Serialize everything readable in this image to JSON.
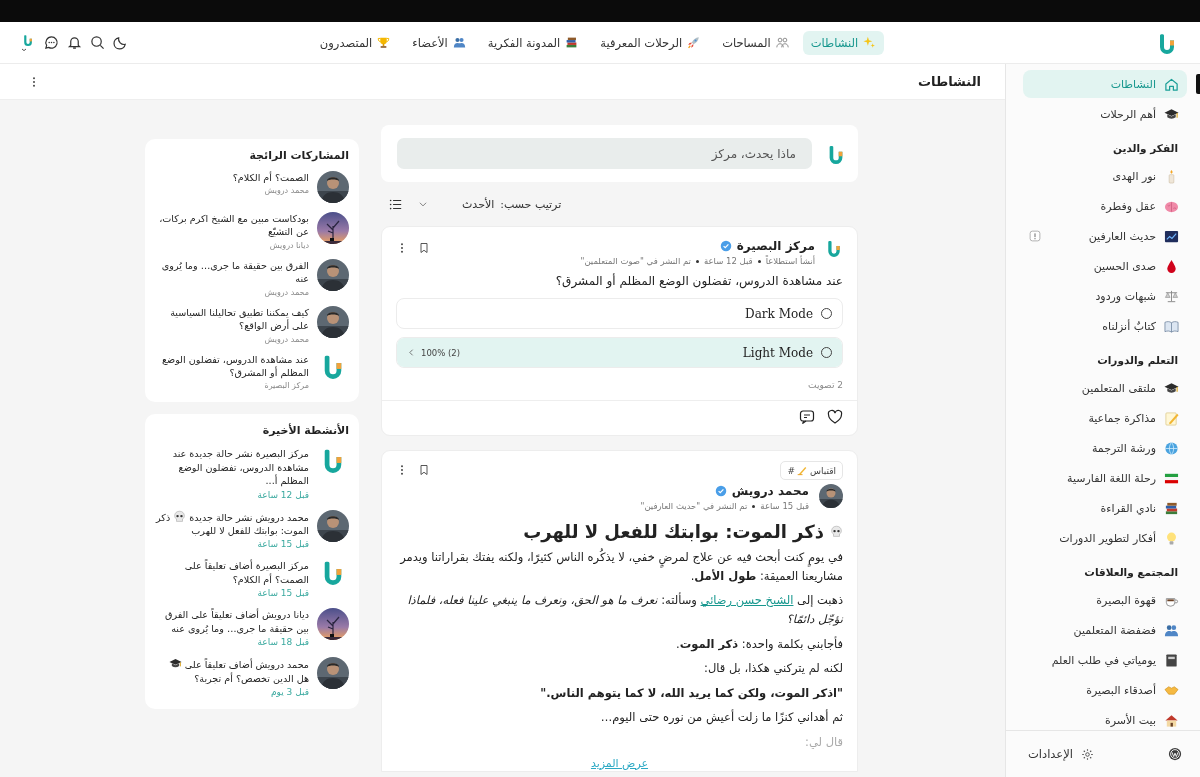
{
  "header": {
    "nav": [
      {
        "label": "النشاطات",
        "selected": true
      },
      {
        "label": "المساحات",
        "selected": false
      },
      {
        "label": "الرحلات المعرفية",
        "selected": false
      },
      {
        "label": "المدونة الفكرية",
        "selected": false
      },
      {
        "label": "الأعضاء",
        "selected": false
      },
      {
        "label": "المتصدرون",
        "selected": false
      }
    ]
  },
  "sidebar": {
    "groups": [
      {
        "items": [
          {
            "label": "النشاطات",
            "selected": true,
            "notice": false
          },
          {
            "label": "أهم الرحلات",
            "selected": false,
            "notice": false
          }
        ]
      },
      {
        "title": "الفكر والدين",
        "items": [
          {
            "label": "نور الهدى",
            "selected": false,
            "notice": false
          },
          {
            "label": "عقل وفطرة",
            "selected": false,
            "notice": false
          },
          {
            "label": "حديث العارفين",
            "selected": false,
            "notice": true
          },
          {
            "label": "صدى الحسين",
            "selected": false,
            "notice": false
          },
          {
            "label": "شبهات وردود",
            "selected": false,
            "notice": false
          },
          {
            "label": "كتابٌ أنزلناه",
            "selected": false,
            "notice": false
          }
        ]
      },
      {
        "title": "التعلم والدورات",
        "items": [
          {
            "label": "ملتقى المتعلمين",
            "selected": false,
            "notice": false
          },
          {
            "label": "مذاكرة جماعية",
            "selected": false,
            "notice": false
          },
          {
            "label": "ورشة الترجمة",
            "selected": false,
            "notice": false
          },
          {
            "label": "رحلة اللغة الفارسية",
            "selected": false,
            "notice": false
          },
          {
            "label": "نادي القراءة",
            "selected": false,
            "notice": false
          },
          {
            "label": "أفكار لتطوير الدورات",
            "selected": false,
            "notice": false
          }
        ]
      },
      {
        "title": "المجتمع والعلاقات",
        "items": [
          {
            "label": "قهوة البصيرة",
            "selected": false,
            "notice": false
          },
          {
            "label": "فضفضة المتعلمين",
            "selected": false,
            "notice": false
          },
          {
            "label": "يومياتي في طلب العلم",
            "selected": false,
            "notice": false
          },
          {
            "label": "أصدقاء البصيرة",
            "selected": false,
            "notice": false
          },
          {
            "label": "بيت الأسرة",
            "selected": false,
            "notice": false
          }
        ]
      }
    ],
    "settings": "الإعدادات"
  },
  "page_title": "النشاطات",
  "composer": {
    "placeholder": "ماذا يحدث، مركز"
  },
  "sort": {
    "label": "ترتيب حسب:",
    "value": "الأحدث"
  },
  "posts": [
    {
      "kind": "poll",
      "author": "مركز البصيرة",
      "avatar": {
        "kind": "logo"
      },
      "verified": true,
      "meta": [
        "أنشأ استطلاعاً",
        "قبل 12 ساعة",
        "تم النشر في \"صوت المتعلمين\""
      ],
      "question": "عند مشاهدة الدروس، تفضلون الوضع المظلم أو المشرق؟",
      "options": [
        {
          "label": "Dark Mode",
          "selected": false
        },
        {
          "label": "Light Mode",
          "selected": false,
          "level": 1,
          "result": "(2) 100%"
        }
      ],
      "votes": "2 تصويت"
    },
    {
      "kind": "article",
      "tag": {
        "prefix": "#",
        "label": "اقتباس"
      },
      "author": "محمد درويش",
      "avatar": {
        "kind": "person"
      },
      "verified": true,
      "meta": [
        "قبل 15 ساعة",
        "تم النشر في \"حديث العارفين\""
      ],
      "title": "ذكر الموت: بوابتك للفعل لا للهرب",
      "paragraphs": [
        {
          "kind": "text",
          "text": "في يومٍ كنت أبحث فيه عن علاج لمرضٍ خفي، لا يذكُره الناس كثيرًا، ولكنه يفتك بقراراتنا ويدمر مشاريعنا العميقة: **طول الأمل**."
        },
        {
          "kind": "link",
          "before": "ذهبت إلى ",
          "link": "الشيخ حسن رضائي",
          "after": " وسألته: *نعرف ما هو الحق، ونعرف ما ينبغي علينا فعله، فلماذا نؤجّل دائمًا؟*"
        },
        {
          "kind": "text",
          "text": "فأجابني بكلمة واحدة: **ذكر الموت**."
        },
        {
          "kind": "text",
          "text": "لكنه لم يتركني هكذا، بل قال:"
        },
        {
          "kind": "quote",
          "text": "\"اذكر الموت، ولكن كما يريد الله، لا كما يتوهم الناس.\""
        },
        {
          "kind": "text",
          "text": "ثم أهداني كنزًا ما زلت أعيش من نوره حتى اليوم…"
        },
        {
          "kind": "faded",
          "text": "قال لي:"
        }
      ],
      "more": "عرض المزيد"
    }
  ],
  "trending": {
    "title": "المشاركات الرائجة",
    "items": [
      {
        "title": "الصمت؟ أم الكلام؟",
        "author": "محمد درويش",
        "avatar": {
          "kind": "person"
        }
      },
      {
        "title": "بودكاست مبين مع الشيخ اكرم بركات، عن التشيّع",
        "author": "ديانا درويش",
        "avatar": {
          "kind": "sky"
        }
      },
      {
        "title": "الفرق بين حقيقة ما جرى… وما يُروى عنه",
        "author": "محمد درويش",
        "avatar": {
          "kind": "person"
        }
      },
      {
        "title": "كيف يمكننا تطبيق تحاليلنا السياسية على أرض الواقع؟",
        "author": "محمد درويش",
        "avatar": {
          "kind": "person"
        }
      },
      {
        "title": "عند مشاهدة الدروس، تفضلون الوضع المظلم أو المشرق؟",
        "author": "مركز البصيرة",
        "avatar": {
          "kind": "logo"
        }
      }
    ]
  },
  "recent": {
    "title": "الأنشطة الأخيرة",
    "items": [
      {
        "text": "مركز البصيرة نشر حالة جديدة عند مشاهدة الدروس، تفضلون الوضع المظلم أ...",
        "time": "قبل 12 ساعة",
        "avatar": {
          "kind": "logo"
        }
      },
      {
        "text": "محمد درويش نشر حالة جديدة ",
        "icon": {
          "kind": "skull"
        },
        "text_end": " ذكر الموت: بوابتك للفعل لا للهرب",
        "time": "قبل 15 ساعة",
        "avatar": {
          "kind": "person"
        }
      },
      {
        "text": "مركز البصيرة أضاف تعليقاً على الصمت؟ أم الكلام؟",
        "time": "قبل 15 ساعة",
        "avatar": {
          "kind": "logo"
        }
      },
      {
        "text": "ديانا درويش أضاف تعليقاً على الفرق بين حقيقة ما جرى… وما يُروى عنه",
        "time": "قبل 18 ساعة",
        "avatar": {
          "kind": "sky"
        }
      },
      {
        "text": "محمد درويش أضاف تعليقاً على ",
        "icon": {
          "kind": "cap"
        },
        "text_end": " هل الدين تخصص؟ أم تجربة؟",
        "time": "قبل 3 يوم",
        "avatar": {
          "kind": "person"
        }
      }
    ]
  }
}
